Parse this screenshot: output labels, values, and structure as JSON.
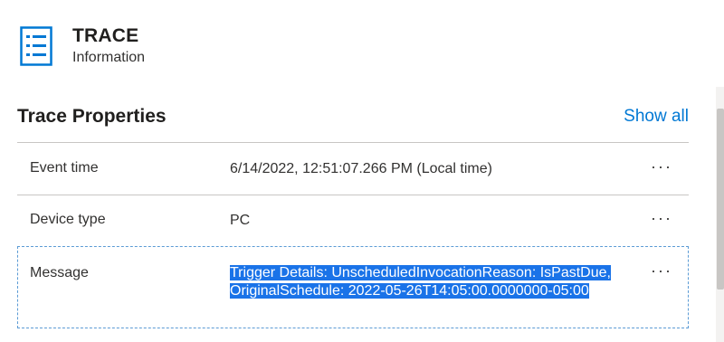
{
  "header": {
    "title": "TRACE",
    "subtitle": "Information",
    "icon": "list-icon",
    "icon_color": "#0078d4"
  },
  "section": {
    "title": "Trace Properties",
    "show_all": "Show all"
  },
  "properties": [
    {
      "label": "Event time",
      "value": "6/14/2022, 12:51:07.266 PM (Local time)",
      "more": "···"
    },
    {
      "label": "Device type",
      "value": "PC",
      "more": "···"
    },
    {
      "label": "Message",
      "value": "Trigger Details: UnscheduledInvocationReason: IsPastDue, OriginalSchedule: 2022-05-26T14:05:00.0000000-05:00",
      "more": "···"
    }
  ],
  "colors": {
    "accent": "#0078d4",
    "selection": "#1a73e8"
  }
}
